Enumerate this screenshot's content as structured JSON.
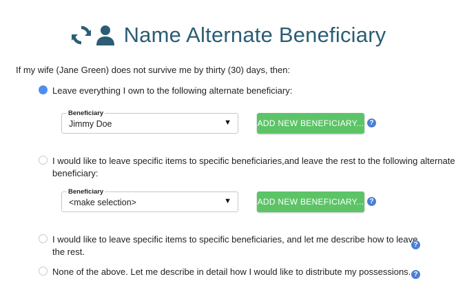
{
  "header": {
    "title": "Name Alternate Beneficiary",
    "icons": [
      "sync-icon",
      "user-icon"
    ],
    "color": "#2b5d74"
  },
  "intro_text": "If my wife (Jane Green) does not survive me by thirty (30) days, then:",
  "options": [
    {
      "id": "leave-everything",
      "selected": true,
      "text": "Leave everything I own to the following alternate  beneficiary:"
    },
    {
      "id": "specific-and-rest",
      "selected": false,
      "text_line1": "I would like to leave specific items to specific beneficiaries,and leave the rest to the following alternate",
      "text_line2": "beneficiary:"
    },
    {
      "id": "specific-describe",
      "selected": false,
      "text_line1": "I would like to leave specific items to specific beneficiaries, and let me describe how to leave",
      "text_line2": "the rest."
    },
    {
      "id": "none-of-above",
      "selected": false,
      "text": "None of the above.  Let me describe in detail how I would like to distribute my possessions."
    }
  ],
  "selects": [
    {
      "legend": "Beneficiary",
      "value": "Jimmy Doe"
    },
    {
      "legend": "Beneficiary",
      "value": "<make selection>"
    }
  ],
  "add_button_label": "ADD NEW BENEFICIARY...",
  "help_glyph": "?",
  "select_arrow": "▼",
  "colors": {
    "accent_blue": "#4f8dee",
    "button_green": "#5cc467",
    "help_blue": "#4b7fd6"
  }
}
